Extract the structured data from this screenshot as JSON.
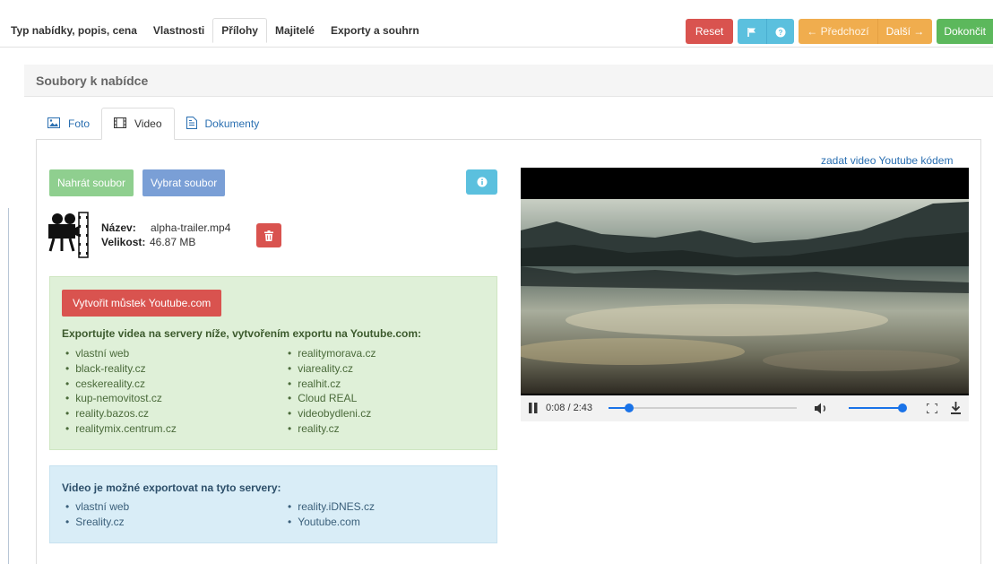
{
  "nav": {
    "tabs": [
      {
        "label": "Typ nabídky, popis, cena",
        "active": false
      },
      {
        "label": "Vlastnosti",
        "active": false
      },
      {
        "label": "Přílohy",
        "active": true
      },
      {
        "label": "Majitelé",
        "active": false
      },
      {
        "label": "Exporty a souhrn",
        "active": false
      }
    ],
    "reset": "Reset",
    "prev": "← Předchozí",
    "next": "Další →",
    "finish": "Dokončit"
  },
  "section": {
    "title": "Soubory k nabídce"
  },
  "subtabs": [
    {
      "label": "Foto",
      "icon": "image-icon"
    },
    {
      "label": "Video",
      "icon": "film-icon",
      "active": true
    },
    {
      "label": "Dokumenty",
      "icon": "document-icon"
    }
  ],
  "upload": {
    "upload_label": "Nahrát soubor",
    "choose_label": "Vybrat soubor"
  },
  "file": {
    "name_label": "Název:",
    "name": "alpha-trailer.mp4",
    "size_label": "Velikost:",
    "size": "46.87 MB"
  },
  "youtube_export": {
    "button": "Vytvořit můstek Youtube.com",
    "title": "Exportujte videa na servery níže, vytvořením exportu na Youtube.com:",
    "col1": [
      "vlastní web",
      "black-reality.cz",
      "ceskereality.cz",
      "kup-nemovitost.cz",
      "reality.bazos.cz",
      "realitymix.centrum.cz"
    ],
    "col2": [
      "realitymorava.cz",
      "viareality.cz",
      "realhit.cz",
      "Cloud REAL",
      "videobydleni.cz",
      "reality.cz"
    ]
  },
  "export_servers": {
    "title": "Video je možné exportovat na tyto servery:",
    "col1": [
      "vlastní web",
      "Sreality.cz"
    ],
    "col2": [
      "reality.iDNES.cz",
      "Youtube.com"
    ]
  },
  "video": {
    "link": "zadat video Youtube kódem",
    "time": "0:08 / 2:43",
    "progress": 0.049,
    "volume": 1.0
  },
  "colors": {
    "danger": "#d9534f",
    "info": "#5bc0de",
    "warning": "#f0ad4e",
    "success": "#5cb85c",
    "link": "#2a6fb1"
  }
}
